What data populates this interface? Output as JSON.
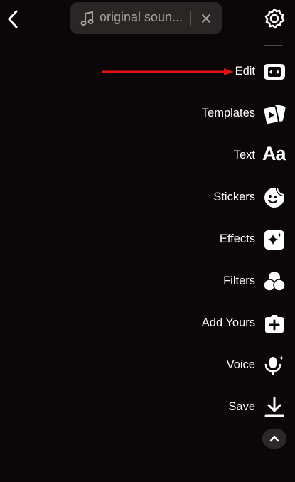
{
  "sound": {
    "label": "original soun..."
  },
  "tools": {
    "edit": "Edit",
    "templates": "Templates",
    "text": "Text",
    "text_icon": "Aa",
    "stickers": "Stickers",
    "effects": "Effects",
    "filters": "Filters",
    "add_yours": "Add Yours",
    "voice": "Voice",
    "save": "Save"
  },
  "icons": [
    "back-arrow-icon",
    "music-note-icon",
    "close-icon",
    "gear-icon",
    "edit-icon",
    "templates-icon",
    "text-icon",
    "stickers-icon",
    "effects-icon",
    "filters-icon",
    "add-yours-icon",
    "voice-icon",
    "save-icon",
    "chevron-up-icon"
  ],
  "colors": {
    "background": "#0b0708",
    "annotation_arrow": "#e01212",
    "pill": "#2a2626"
  }
}
